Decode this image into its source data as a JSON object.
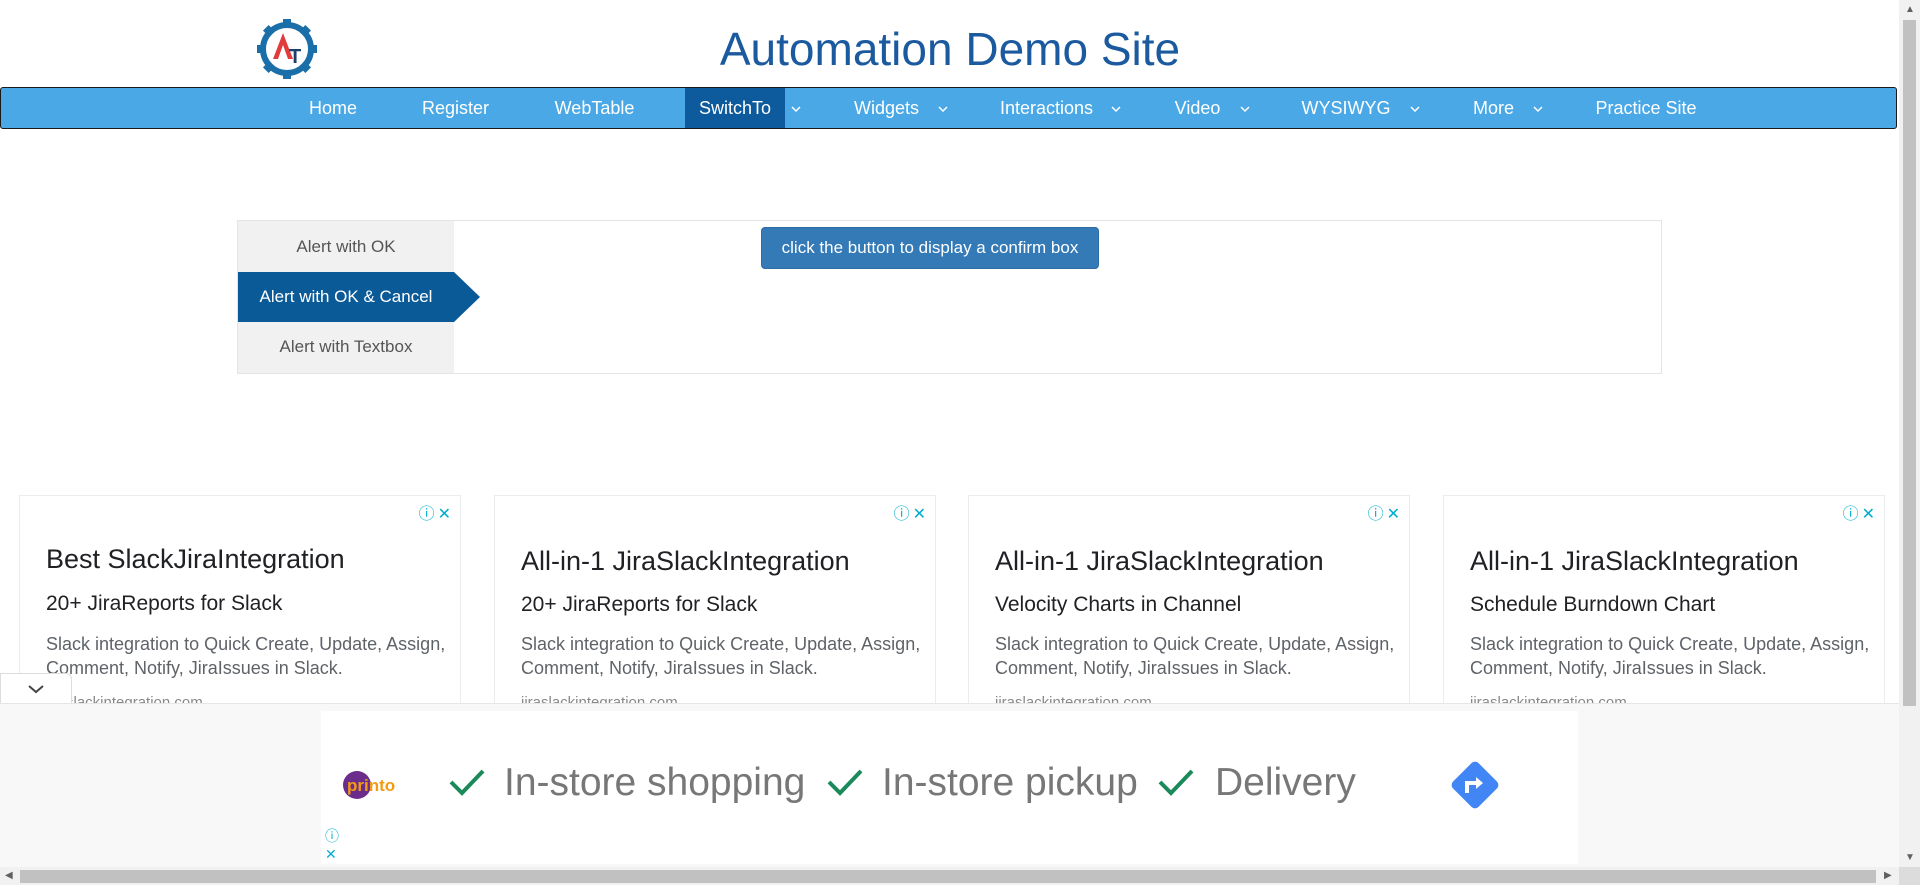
{
  "header": {
    "title": "Automation Demo Site",
    "logo_text": "AT"
  },
  "nav": {
    "items": [
      {
        "label": "Home"
      },
      {
        "label": "Register"
      },
      {
        "label": "WebTable"
      },
      {
        "label": "SwitchTo"
      },
      {
        "label": "Widgets"
      },
      {
        "label": "Interactions"
      },
      {
        "label": "Video"
      },
      {
        "label": "WYSIWYG"
      },
      {
        "label": "More"
      },
      {
        "label": "Practice Site"
      }
    ]
  },
  "alerts": {
    "tabs": [
      {
        "label": "Alert with OK"
      },
      {
        "label": "Alert with OK & Cancel"
      },
      {
        "label": "Alert with Textbox"
      }
    ],
    "active_tab": "Alert with OK & Cancel",
    "button_label": "click the button to display a confirm box"
  },
  "ads": [
    {
      "title": "Best SlackJiraIntegration",
      "subtitle": "20+ JiraReports for Slack",
      "description": "Slack integration to Quick Create, Update, Assign, Comment, Notify, JiraIssues in Slack.",
      "url": "jiraslackintegration.com"
    },
    {
      "title": "All-in-1 JiraSlackIntegration",
      "subtitle": "20+ JiraReports for Slack",
      "description": "Slack integration to Quick Create, Update, Assign, Comment, Notify, JiraIssues in Slack.",
      "url": "jiraslackintegration.com"
    },
    {
      "title": "All-in-1 JiraSlackIntegration",
      "subtitle": "Velocity Charts in Channel",
      "description": "Slack integration to Quick Create, Update, Assign, Comment, Notify, JiraIssues in Slack.",
      "url": "jiraslackintegration.com"
    },
    {
      "title": "All-in-1 JiraSlackIntegration",
      "subtitle": "Schedule Burndown Chart",
      "description": "Slack integration to Quick Create, Update, Assign, Comment, Notify, JiraIssues in Slack.",
      "url": "jiraslackintegration.com"
    }
  ],
  "banner": {
    "brand": "printo",
    "features": [
      "In-store shopping",
      "In-store pickup",
      "Delivery"
    ]
  },
  "colors": {
    "nav": "#4aa8e6",
    "nav_active": "#0d5a9c",
    "title": "#1b5a9e",
    "button": "#337ab7",
    "check": "#1a8a5a"
  }
}
